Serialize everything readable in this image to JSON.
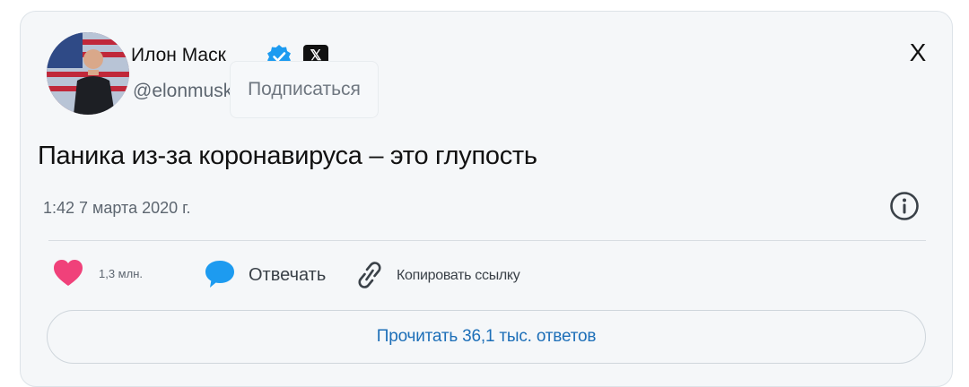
{
  "tweet": {
    "author_name": "Илон Маск",
    "handle": "@elonmusk",
    "subscribe_label": "Подписаться",
    "close_label": "X",
    "x_badge": "𝕏",
    "text": "Паника из-за коронавируса – это глупость",
    "timestamp": "1:42 7 марта 2020 г."
  },
  "actions": {
    "like_count": "1,3 млн.",
    "reply_label": "Отвечать",
    "copy_link_label": "Копировать ссылку"
  },
  "footer": {
    "read_replies_label": "Прочитать 36,1 тыс. ответов"
  },
  "colors": {
    "like": "#f0417a",
    "reply": "#1d9bf0",
    "verified": "#1d9bf0",
    "link_text": "#1d6fb8"
  },
  "icons": {
    "verified": "verified-badge-icon",
    "like": "heart-icon",
    "reply": "speech-bubble-icon",
    "link": "link-icon",
    "info": "info-icon"
  }
}
